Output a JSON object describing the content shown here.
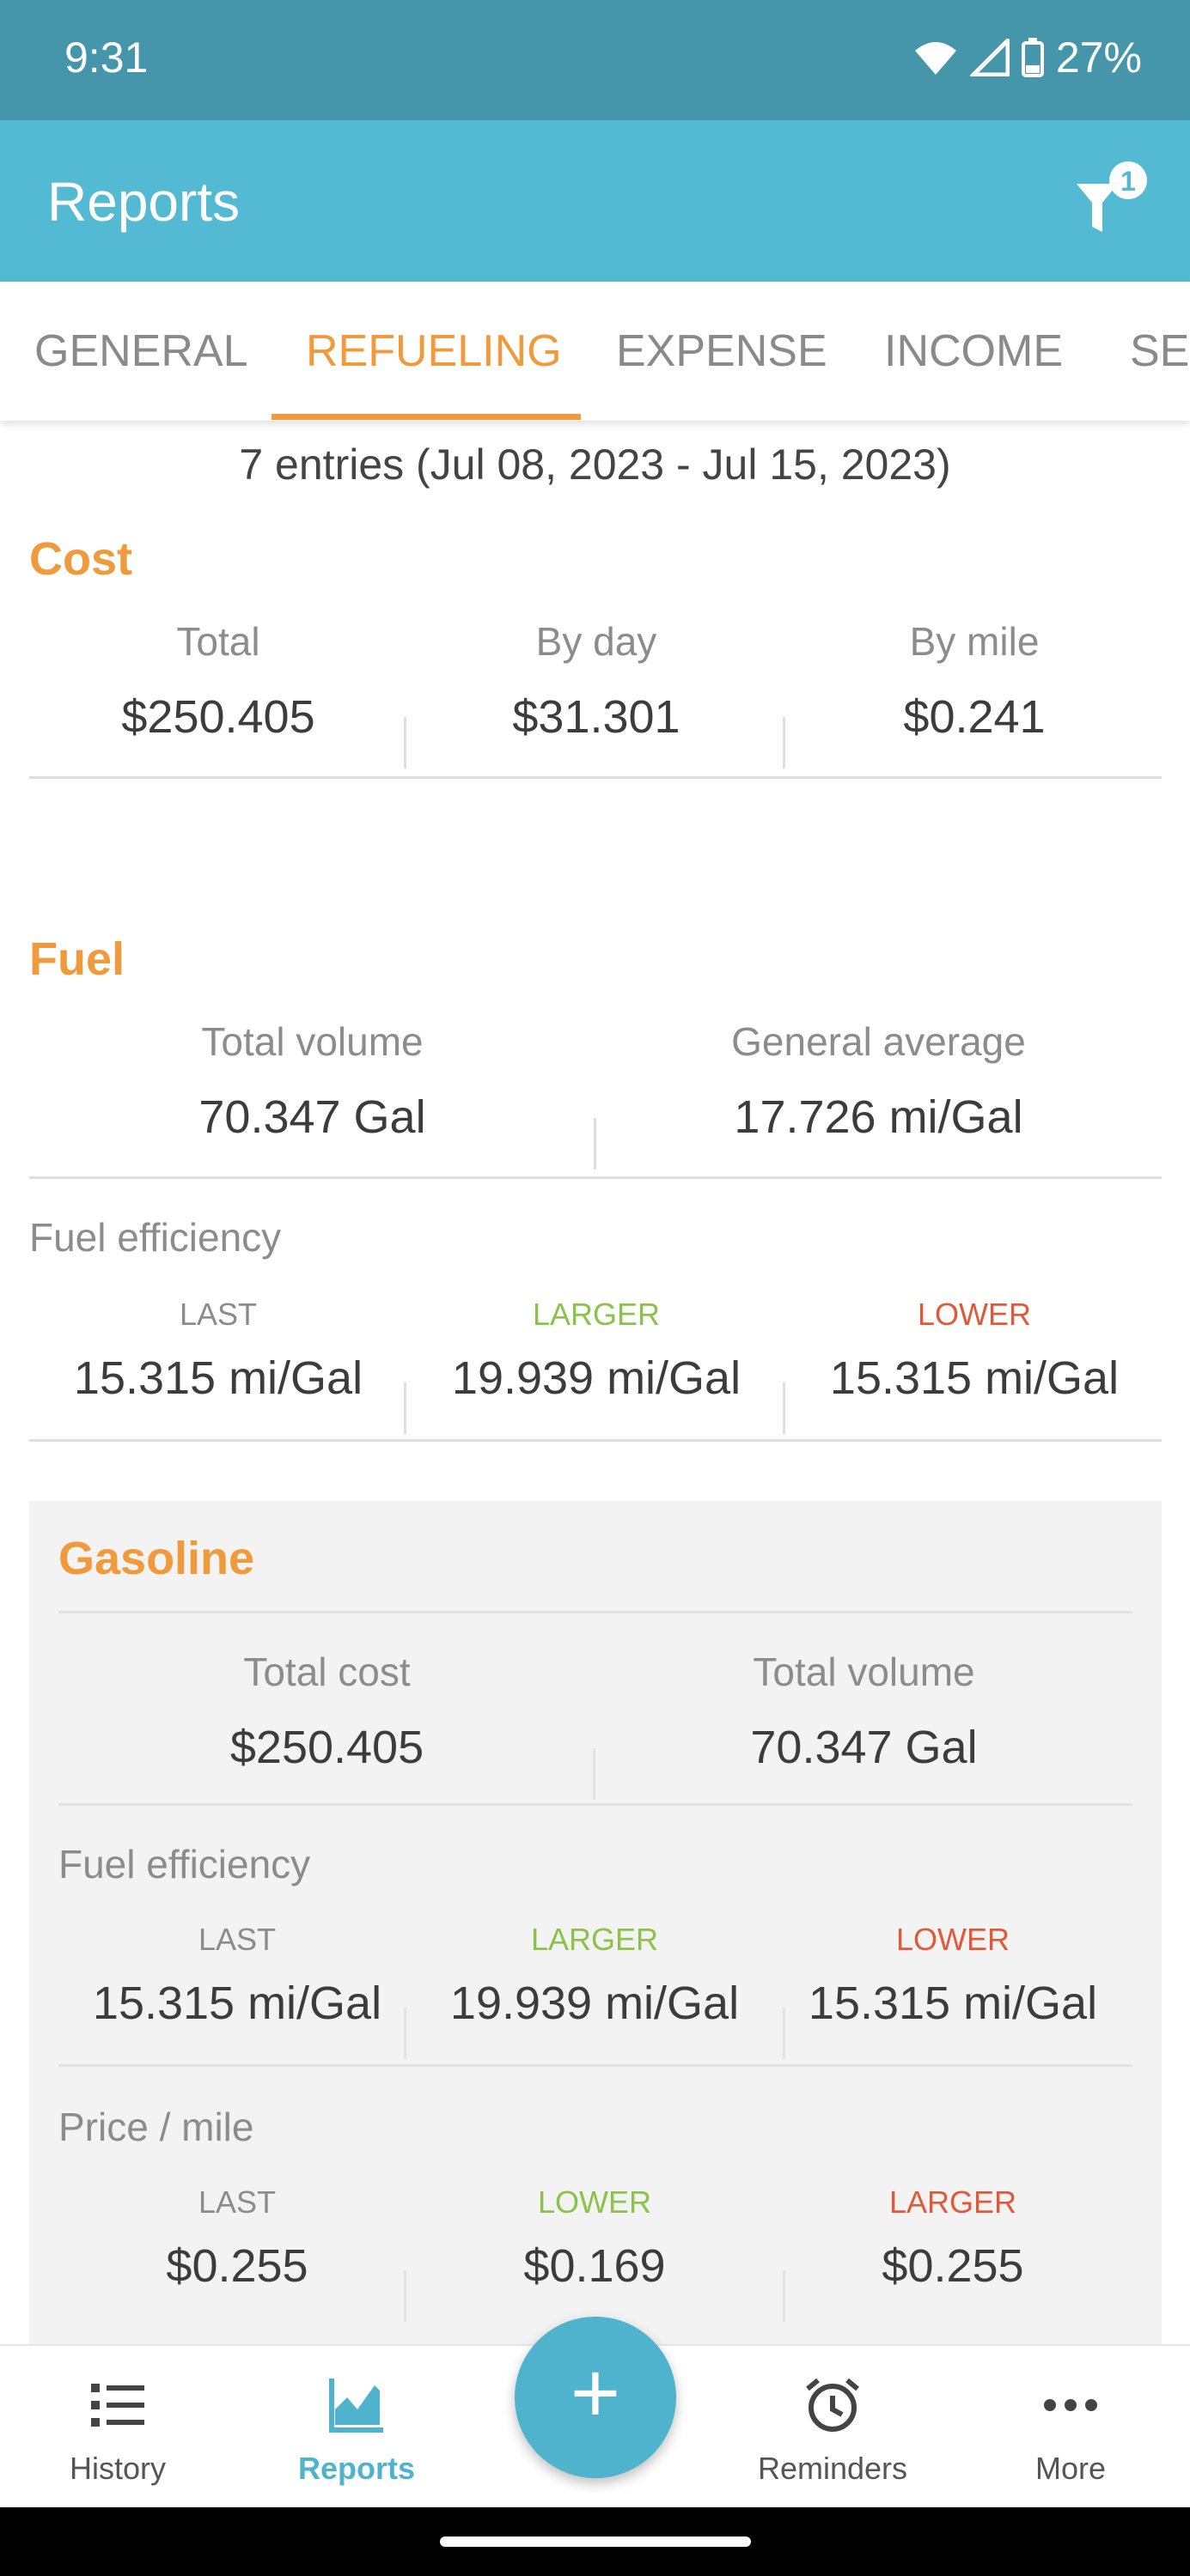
{
  "status_bar": {
    "time": "9:31",
    "battery": "27%"
  },
  "app_bar": {
    "title": "Reports",
    "filter_badge": "1"
  },
  "tabs": [
    {
      "label": "GENERAL"
    },
    {
      "label": "REFUELING"
    },
    {
      "label": "EXPENSE"
    },
    {
      "label": "INCOME"
    },
    {
      "label": "SER"
    }
  ],
  "summary": {
    "entries": "7 entries (Jul 08, 2023 - Jul 15, 2023)"
  },
  "cost": {
    "title": "Cost",
    "total_label": "Total",
    "total_value": "$250.405",
    "by_day_label": "By day",
    "by_day_value": "$31.301",
    "by_mile_label": "By mile",
    "by_mile_value": "$0.241"
  },
  "fuel": {
    "title": "Fuel",
    "total_volume_label": "Total volume",
    "total_volume_value": "70.347 Gal",
    "general_average_label": "General average",
    "general_average_value": "17.726 mi/Gal",
    "efficiency_title": "Fuel efficiency",
    "last_label": "LAST",
    "last_value": "15.315 mi/Gal",
    "larger_label": "LARGER",
    "larger_value": "19.939 mi/Gal",
    "lower_label": "LOWER",
    "lower_value": "15.315 mi/Gal"
  },
  "gasoline": {
    "title": "Gasoline",
    "total_cost_label": "Total cost",
    "total_cost_value": "$250.405",
    "total_volume_label": "Total volume",
    "total_volume_value": "70.347 Gal",
    "efficiency_title": "Fuel efficiency",
    "eff_last_label": "LAST",
    "eff_last_value": "15.315 mi/Gal",
    "eff_larger_label": "LARGER",
    "eff_larger_value": "19.939 mi/Gal",
    "eff_lower_label": "LOWER",
    "eff_lower_value": "15.315 mi/Gal",
    "price_title": "Price / mile",
    "price_last_label": "LAST",
    "price_last_value": "$0.255",
    "price_lower_label": "LOWER",
    "price_lower_value": "$0.169",
    "price_larger_label": "LARGER",
    "price_larger_value": "$0.255"
  },
  "bottom_nav": {
    "history": "History",
    "reports": "Reports",
    "add": "+",
    "reminders": "Reminders",
    "more": "More"
  },
  "colors": {
    "accent": "#f09a3c",
    "status_bar": "#4596aa",
    "app_bar": "#54b9d2",
    "fab": "#4fb3cd",
    "green": "#8bc24a",
    "red": "#e05a3a"
  },
  "icons": [
    "wifi-icon",
    "signal-icon",
    "battery-icon",
    "filter-icon",
    "history-icon",
    "reports-icon",
    "add-icon",
    "alarm-icon",
    "more-icon"
  ]
}
